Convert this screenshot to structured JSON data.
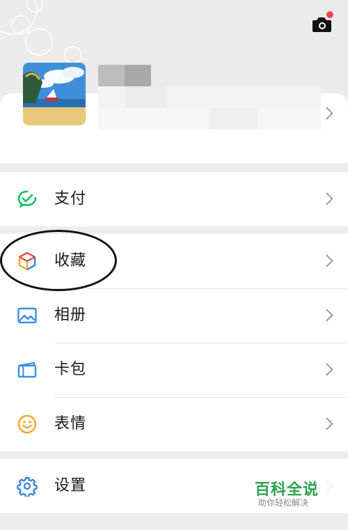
{
  "menu": {
    "items": [
      {
        "id": "pay",
        "label": "支付",
        "icon": "wechat-pay-icon"
      },
      {
        "id": "favorites",
        "label": "收藏",
        "icon": "favorites-cube-icon"
      },
      {
        "id": "album",
        "label": "相册",
        "icon": "album-image-icon"
      },
      {
        "id": "cards",
        "label": "卡包",
        "icon": "card-wallet-icon"
      },
      {
        "id": "stickers",
        "label": "表情",
        "icon": "smiley-face-icon"
      },
      {
        "id": "settings",
        "label": "设置",
        "icon": "gear-icon"
      }
    ]
  },
  "camera": {
    "icon": "camera-icon",
    "notification_dot": true
  },
  "watermark": {
    "title": "百科全说",
    "subtitle": "助你轻松解决"
  },
  "colors": {
    "pay_green": "#07c160",
    "settings_blue": "#2a7fe0",
    "stickers_orange": "#f5a623",
    "album_blue": "#3a8ee6",
    "watermark_green": "#2ba24c",
    "notification_red": "#f04848"
  }
}
